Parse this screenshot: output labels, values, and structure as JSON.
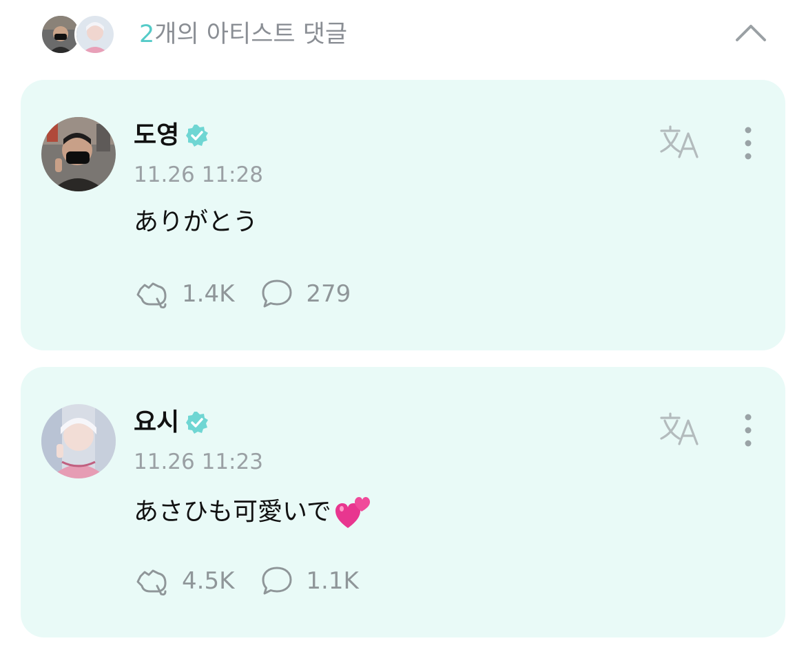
{
  "header": {
    "count": "2",
    "title_rest": "개의 아티스트 댓글"
  },
  "comments": [
    {
      "name": "도영",
      "timestamp": "11.26 11:28",
      "message": "ありがとう",
      "emoji": "",
      "likes": "1.4K",
      "replies": "279"
    },
    {
      "name": "요시",
      "timestamp": "11.26 11:23",
      "message": "あさひも可愛いで",
      "emoji": "💕",
      "likes": "4.5K",
      "replies": "1.1K"
    }
  ],
  "icons": {
    "collapse": "chevron-up-icon",
    "verified": "verified-badge-icon",
    "translate": "translate-icon",
    "more": "more-vertical-icon",
    "like": "cheer-hand-icon",
    "reply": "speech-bubble-icon"
  },
  "colors": {
    "accent": "#55cbc8",
    "card_bg": "#e9faf7",
    "icon_gray": "#8f9699",
    "verified": "#6fd6d3"
  }
}
